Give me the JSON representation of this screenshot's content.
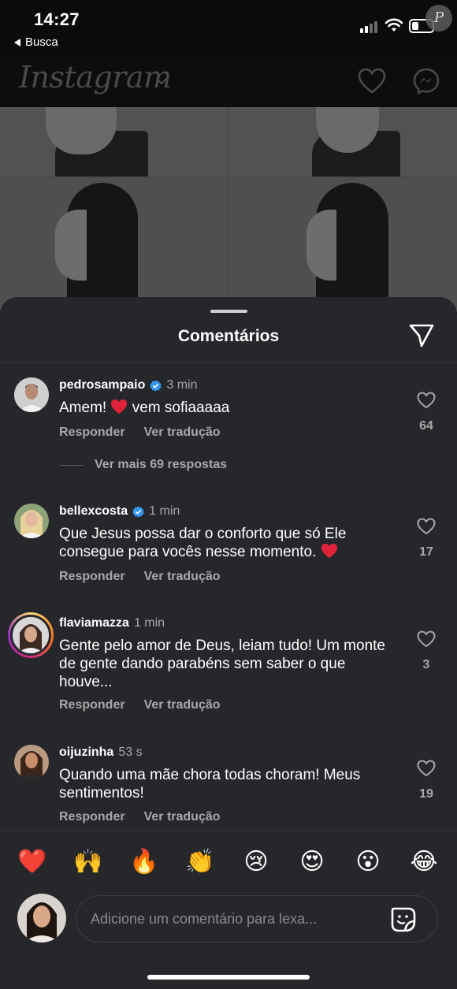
{
  "status_bar": {
    "time": "14:27",
    "back_label": "Busca",
    "watermark": "P"
  },
  "header": {
    "logo": "Instagram"
  },
  "sheet": {
    "title": "Comentários"
  },
  "comments": [
    {
      "username": "pedrosampaio",
      "verified": true,
      "time": "3 min",
      "text": "Amem!",
      "text_after_emoji": "vem sofiaaaaa",
      "reply_label": "Responder",
      "translate_label": "Ver tradução",
      "likes": "64",
      "more_replies": "Ver mais 69 respostas"
    },
    {
      "username": "bellexcosta",
      "verified": true,
      "time": "1 min",
      "text": "Que Jesus possa dar o conforto que só Ele consegue para vocês nesse momento.",
      "reply_label": "Responder",
      "translate_label": "Ver tradução",
      "likes": "17"
    },
    {
      "username": "flaviamazza",
      "verified": false,
      "time": "1 min",
      "text": "Gente pelo amor de Deus, leiam tudo! Um monte de gente dando parabéns sem saber o que houve...",
      "reply_label": "Responder",
      "translate_label": "Ver tradução",
      "likes": "3"
    },
    {
      "username": "oijuzinha",
      "verified": false,
      "time": "53 s",
      "text": "Quando uma mãe chora todas choram! Meus sentimentos!",
      "reply_label": "Responder",
      "translate_label": "Ver tradução",
      "likes": "19"
    }
  ],
  "quick_reactions": [
    "❤️",
    "🙌",
    "🔥",
    "👏",
    "😢",
    "😍",
    "😮",
    "😂"
  ],
  "composer": {
    "placeholder": "Adicione um comentário para lexa..."
  },
  "colors": {
    "sheet_bg": "#25272b",
    "secondary_text": "#a8a8a8",
    "verified_blue": "#3897f0",
    "heart_red": "#ed4956"
  }
}
